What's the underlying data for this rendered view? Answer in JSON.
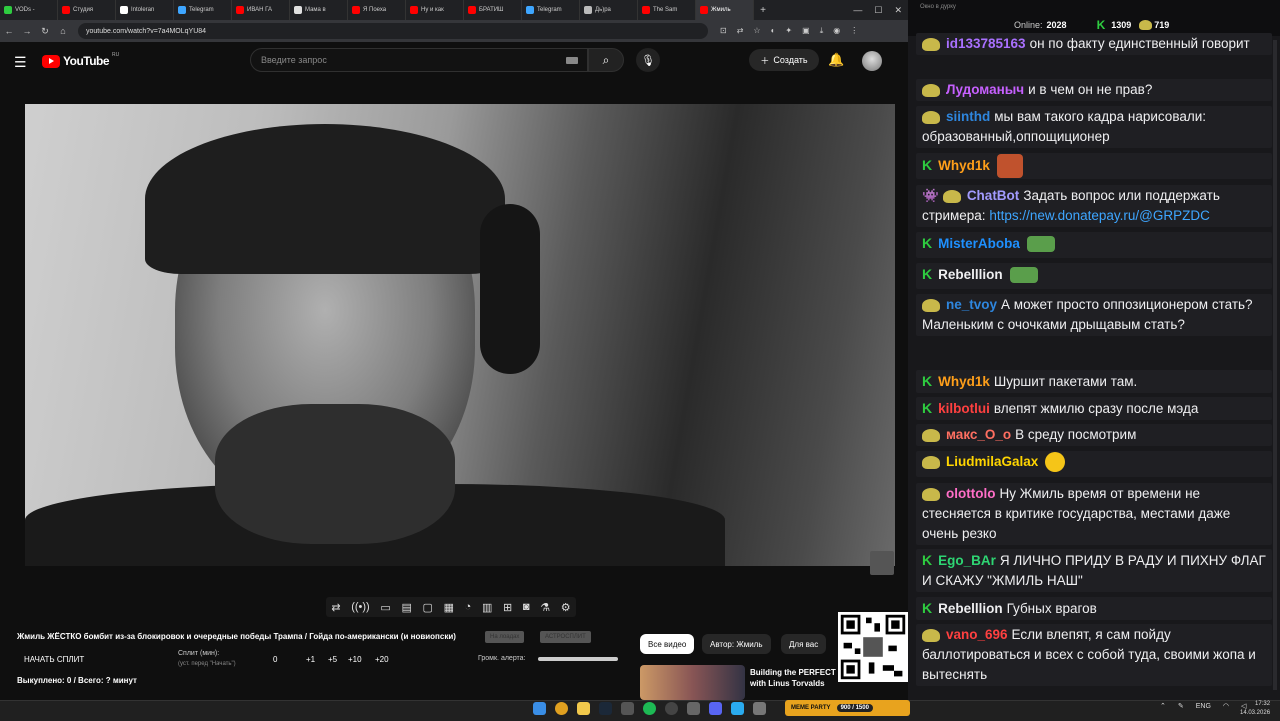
{
  "browser": {
    "tabs": [
      {
        "label": "VODs - ",
        "color": "#2ecc40"
      },
      {
        "label": "Студия",
        "color": "#ff0000"
      },
      {
        "label": "Intoleran",
        "color": "#ffffff"
      },
      {
        "label": "Telegram",
        "color": "#3ea6ff"
      },
      {
        "label": "ИВАН ГА",
        "color": "#ff0000"
      },
      {
        "label": "Мама в",
        "color": "#e0e0e0"
      },
      {
        "label": "Я Поеха",
        "color": "#ff0000"
      },
      {
        "label": "Ну и как",
        "color": "#ff0000"
      },
      {
        "label": "БРАТИШ",
        "color": "#ff0000"
      },
      {
        "label": "Telegram",
        "color": "#3ea6ff"
      },
      {
        "label": "Дь)ра",
        "color": "#bbbbbb"
      },
      {
        "label": "The Sam",
        "color": "#ff0000"
      },
      {
        "label": "Жмиль",
        "color": "#ff0000",
        "active": true
      }
    ],
    "new_tab": "+",
    "window_controls": [
      "—",
      "☐",
      "✕"
    ],
    "url": "youtube.com/watch?v=7a4MOLqYU84"
  },
  "youtube": {
    "logo_text": "YouTube",
    "logo_region": "RU",
    "search_placeholder": "Введите запрос",
    "create_label": "Создать",
    "video_title": "Жмиль ЖЁСТКО бомбит из-за блокировок и очередные победы Трампа / Гойда по-американски (и новиопски)",
    "pill1": "На лоадах",
    "pill2": "АСТРОСПЛИТ",
    "split_label": "НАЧАТЬ СПЛИТ",
    "split_minutes": "Сплит (мин):",
    "split_sub": "(уст. перед \"Начать\")",
    "split_values": [
      "0",
      "+1",
      "+5",
      "+10",
      "+20"
    ],
    "alert_label": "Громк. алерта:",
    "ransom": "Выкуплено: 0 / Всего: ? минут",
    "chips": [
      "Все видео",
      "Автор: Жмиль",
      "Для вас"
    ],
    "rec_title_line1": "Building the PERFECT",
    "rec_title_line2": "with Linus Torvalds"
  },
  "chat": {
    "titlebar": "Окно в дурку",
    "online_label": "Online:",
    "online_value": "2028",
    "k_count": "1309",
    "head_count": "719",
    "messages": [
      {
        "user": "id133785163",
        "color": "#a970ff",
        "text": "он по факту единственный говорит",
        "badge": "head"
      },
      {
        "user": "Лудоманыч",
        "color": "#c660ff",
        "text": "и в чем он не прав?",
        "badge": "head"
      },
      {
        "user": "siinthd",
        "color": "#2e86de",
        "text": "мы вам такого кадра нарисовали: образованный,оппощиционер",
        "badge": "head"
      },
      {
        "user": "Whyd1k",
        "color": "#ff9f1a",
        "text": "",
        "badge": "k"
      },
      {
        "user": "ChatBot",
        "color": "#a29bfe",
        "text": "Задать вопрос или поддержать стримера:",
        "link": "https://new.donatepay.ru/@GRPZDC",
        "badge": "bot"
      },
      {
        "user": "MisterAboba",
        "color": "#1e90ff",
        "text": "",
        "badge": "k"
      },
      {
        "user": "Rebelllion",
        "color": "#efeff1",
        "text": "",
        "badge": "k"
      },
      {
        "user": "ne_tvoy",
        "color": "#2e86de",
        "text": "А может просто оппозиционером стать? Маленьким с очочками дрыщавым стать?",
        "badge": "head"
      },
      {
        "user": "Whyd1k",
        "color": "#ff9f1a",
        "text": "Шуршит пакетами там.",
        "badge": "k"
      },
      {
        "user": "kilbotlui",
        "color": "#ff4040",
        "text": "влепят жмилю сразу после мэда",
        "badge": "k"
      },
      {
        "user": "макс_О_о",
        "color": "#ff6f61",
        "text": "В среду посмотрим",
        "badge": "head"
      },
      {
        "user": "LiudmilaGalax",
        "color": "#ffd500",
        "text": "",
        "badge": "head"
      },
      {
        "user": "olottolo",
        "color": "#ff6ec7",
        "text": "Ну Жмиль время от времени не стесняется в критике государства, местами даже очень резко",
        "badge": "head"
      },
      {
        "user": "Ego_BAr",
        "color": "#2ed573",
        "text": "Я ЛИЧНО ПРИДУ В РАДУ И ПИХНУ ФЛАГ И СКАЖУ \"ЖМИЛЬ НАШ\"",
        "badge": "k"
      },
      {
        "user": "Rebelllion",
        "color": "#efeff1",
        "text": "Губных врагов",
        "badge": "k"
      },
      {
        "user": "vano_696",
        "color": "#ff4040",
        "text": "Если влепят, я сам пойду баллотироваться и всех с собой туда, своими жопа и вытеснять",
        "badge": "head"
      }
    ]
  },
  "taskbar": {
    "meme_label": "MEME PARTY",
    "meme_progress": "900 / 1500",
    "lang": "ENG",
    "time": "17:32",
    "date": "14.03.2026"
  }
}
